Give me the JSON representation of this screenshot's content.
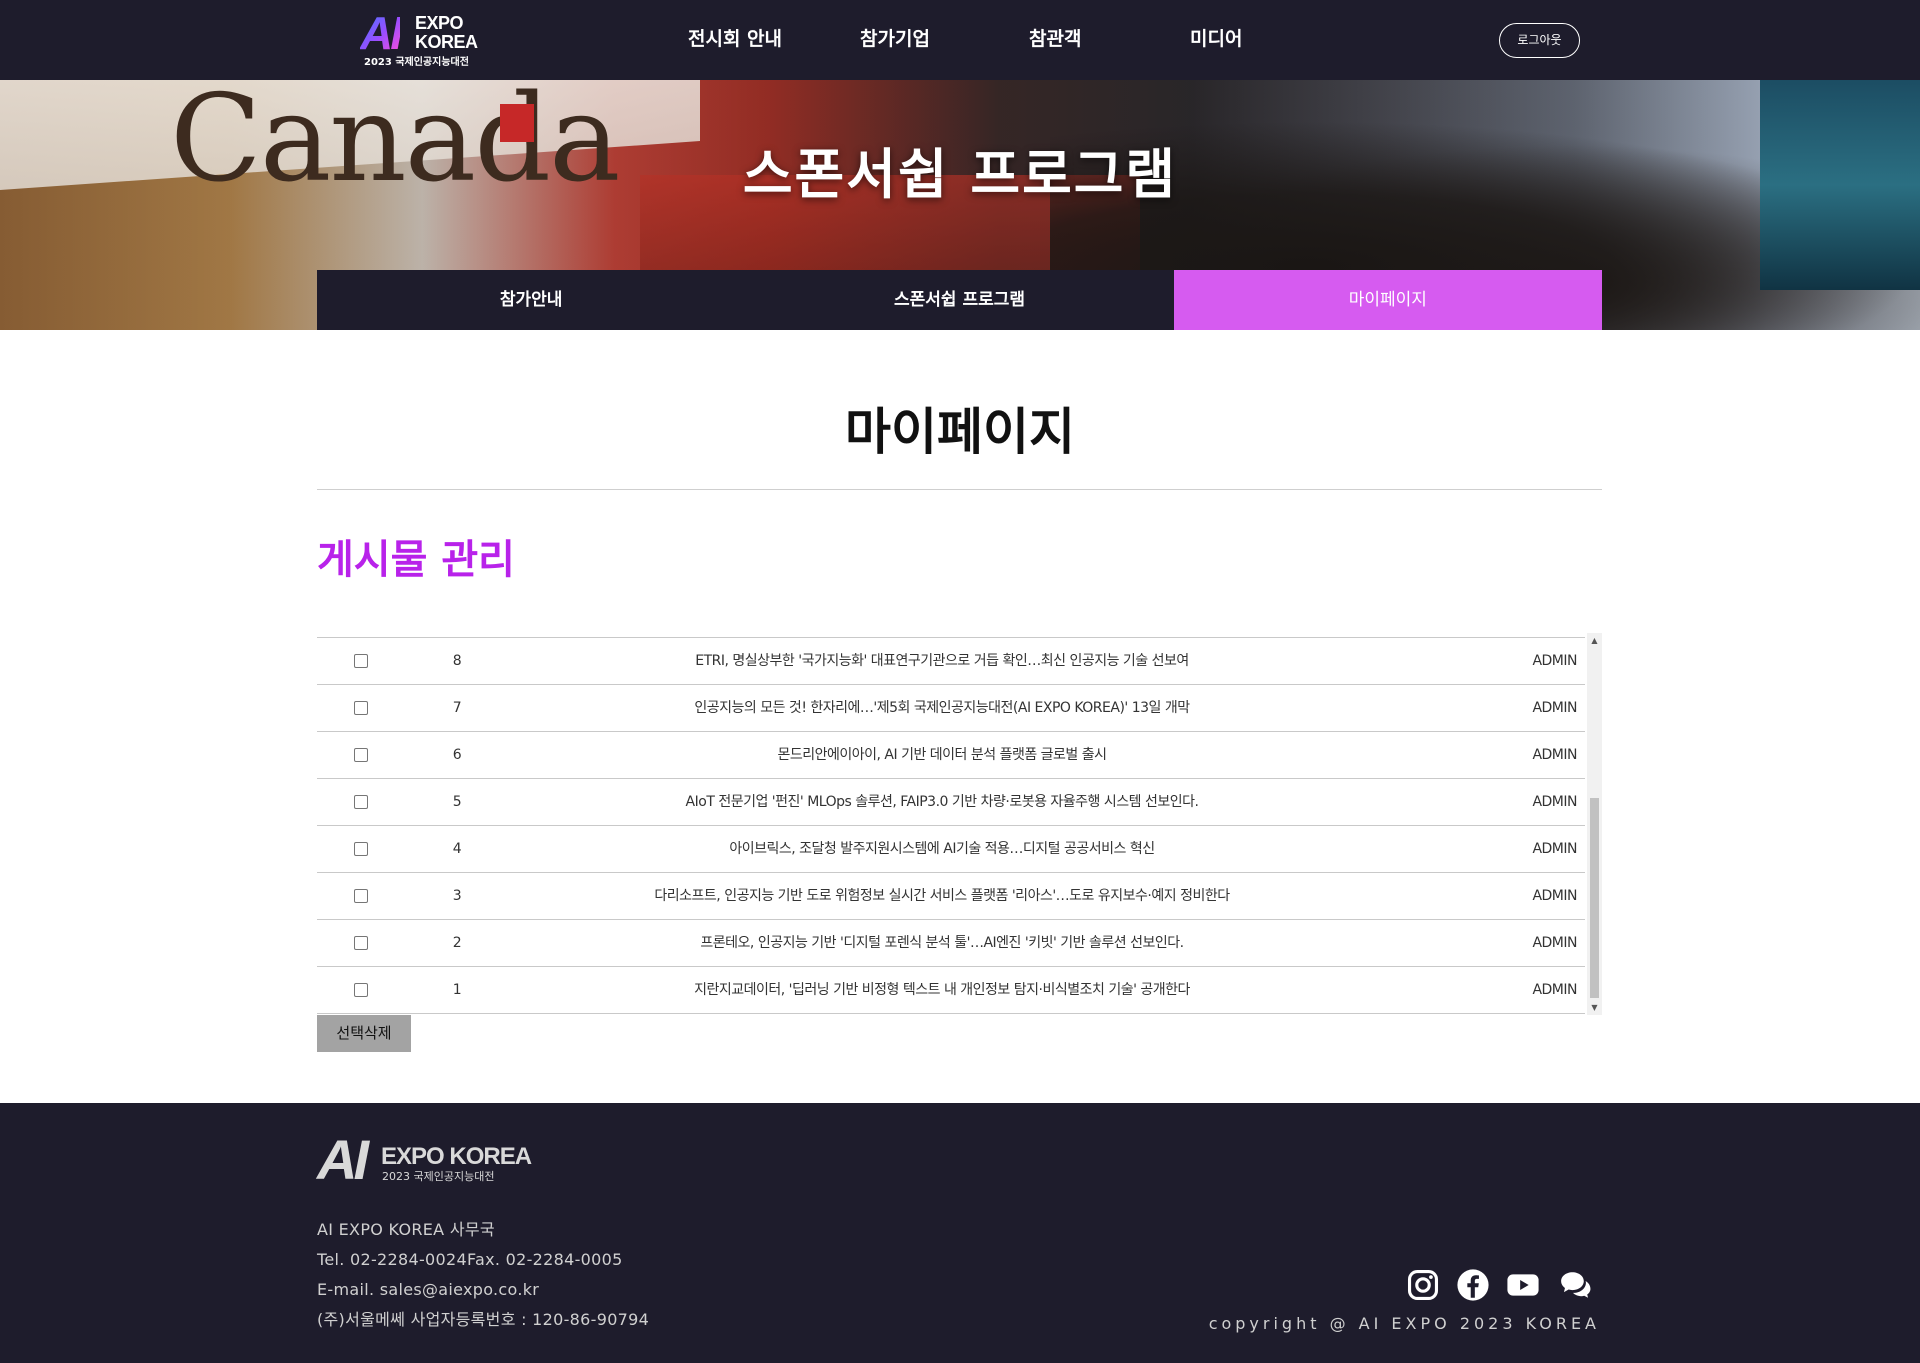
{
  "header": {
    "logo": {
      "ai": "AI",
      "expo": "EXPO",
      "korea": "KOREA",
      "subtitle": "2023 국제인공지능대전"
    },
    "nav": [
      {
        "label": "전시회 안내"
      },
      {
        "label": "참가기업"
      },
      {
        "label": "참관객"
      },
      {
        "label": "미디어"
      }
    ],
    "logout_label": "로그아웃"
  },
  "hero": {
    "title": "스폰서쉽 프로그램",
    "background_text": "Canada",
    "subtabs": [
      {
        "label": "참가안내",
        "active": false
      },
      {
        "label": "스폰서쉽 프로그램",
        "active": false
      },
      {
        "label": "마이페이지",
        "active": true
      }
    ]
  },
  "main": {
    "page_title": "마이페이지",
    "section_title": "게시물 관리",
    "posts": [
      {
        "no": "8",
        "subject": "ETRI, 명실상부한 '국가지능화' 대표연구기관으로 거듭 확인…최신 인공지능 기술 선보여",
        "author": "ADMIN"
      },
      {
        "no": "7",
        "subject": "인공지능의 모든 것! 한자리에…'제5회 국제인공지능대전(AI EXPO KOREA)' 13일 개막",
        "author": "ADMIN"
      },
      {
        "no": "6",
        "subject": "몬드리안에이아이, AI 기반 데이터 분석 플랫폼 글로벌 출시",
        "author": "ADMIN"
      },
      {
        "no": "5",
        "subject": "AIoT 전문기업 '펀진' MLOps 솔루션, FAIP3.0 기반 차량·로봇용 자율주행 시스템 선보인다.",
        "author": "ADMIN"
      },
      {
        "no": "4",
        "subject": "아이브릭스, 조달청 발주지원시스템에 AI기술 적용…디지털 공공서비스 혁신",
        "author": "ADMIN"
      },
      {
        "no": "3",
        "subject": "다리소프트, 인공지능 기반 도로 위험정보 실시간 서비스 플랫폼 '리아스'…도로 유지보수·예지 정비한다",
        "author": "ADMIN"
      },
      {
        "no": "2",
        "subject": "프론테오, 인공지능 기반 '디지털 포렌식 분석 툴'…AI엔진 '키빗' 기반 솔루션 선보인다.",
        "author": "ADMIN"
      },
      {
        "no": "1",
        "subject": "지란지교데이터, '딥러닝 기반 비정형 텍스트 내 개인정보 탐지·비식별조치 기술' 공개한다",
        "author": "ADMIN"
      }
    ],
    "delete_button": "선택삭제"
  },
  "footer": {
    "logo": {
      "ai": "AI",
      "expo": "EXPO KOREA",
      "subtitle": "2023 국제인공지능대전"
    },
    "info": [
      "AI EXPO KOREA 사무국",
      "Tel. 02-2284-0024Fax. 02-2284-0005",
      "E-mail. sales@aiexpo.co.kr",
      "(주)서울메쎄 사업자등록번호 : 120-86-90794"
    ],
    "socials": [
      "instagram-icon",
      "facebook-icon",
      "youtube-icon",
      "chat-icon"
    ],
    "copyright": "copyright @ AI EXPO 2023 KOREA"
  },
  "colors": {
    "header_bg": "#1e1c2c",
    "accent_purple": "#b822ea",
    "active_tab": "#d65bf0",
    "delete_button_bg": "#a3a3a3"
  }
}
